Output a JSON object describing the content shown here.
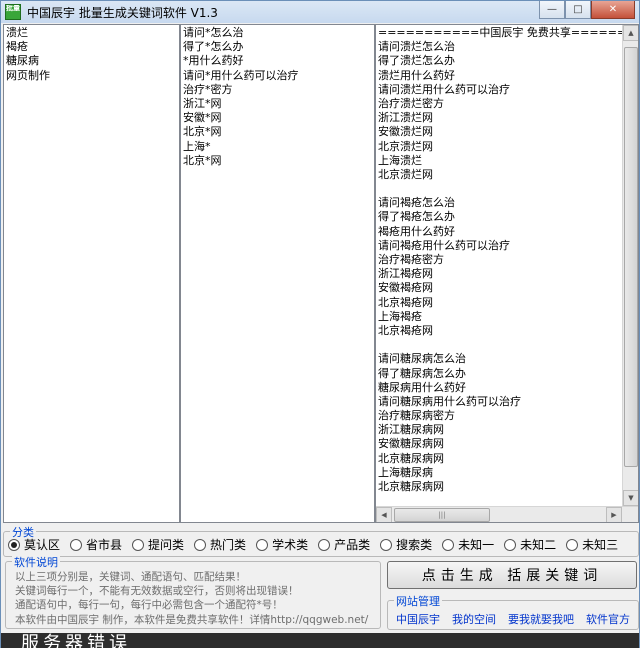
{
  "window": {
    "title": "中国辰宇 批量生成关键词软件 V1.3",
    "icon_text": "批量",
    "minimize": "—",
    "maximize": "□",
    "close": "✕"
  },
  "keywords": [
    "溃烂",
    "褐疮",
    "糖尿病",
    "网页制作"
  ],
  "templates": [
    "请问*怎么治",
    "得了*怎么办",
    "*用什么药好",
    "请问*用什么药可以治疗",
    "治疗*密方",
    "浙江*网",
    "安徽*网",
    "北京*网",
    "上海*",
    "北京*网"
  ],
  "results": [
    "===========中国辰宇 免费共享====================",
    "请问溃烂怎么治",
    "得了溃烂怎么办",
    "溃烂用什么药好",
    "请问溃烂用什么药可以治疗",
    "治疗溃烂密方",
    "浙江溃烂网",
    "安徽溃烂网",
    "北京溃烂网",
    "上海溃烂",
    "北京溃烂网",
    "",
    "请问褐疮怎么治",
    "得了褐疮怎么办",
    "褐疮用什么药好",
    "请问褐疮用什么药可以治疗",
    "治疗褐疮密方",
    "浙江褐疮网",
    "安徽褐疮网",
    "北京褐疮网",
    "上海褐疮",
    "北京褐疮网",
    "",
    "请问糖尿病怎么治",
    "得了糖尿病怎么办",
    "糖尿病用什么药好",
    "请问糖尿病用什么药可以治疗",
    "治疗糖尿病密方",
    "浙江糖尿病网",
    "安徽糖尿病网",
    "北京糖尿病网",
    "上海糖尿病",
    "北京糖尿病网"
  ],
  "category": {
    "label": "分类",
    "selected": "莫认区",
    "options": [
      "莫认区",
      "省市县",
      "提问类",
      "热门类",
      "学术类",
      "产品类",
      "搜索类",
      "未知一",
      "未知二",
      "未知三"
    ]
  },
  "info": {
    "label": "软件说明",
    "lines": [
      "以上三项分别是，关键词、通配语句、匹配结果！",
      "关键词每行一个，不能有无效数据或空行，否则将出现错误！",
      "通配语句中，每行一句，每行中必需包含一个通配符*号！",
      "本软件由中国辰宇 制作，本软件是免费共享软件！详情http://qqgweb.net/"
    ]
  },
  "generate_button": "点击生成 括展关键词",
  "site": {
    "label": "网站管理",
    "links": [
      "中国辰宇",
      "我的空间",
      "要我就娶我吧",
      "软件官方"
    ]
  },
  "bottom_text": "服务器错误"
}
